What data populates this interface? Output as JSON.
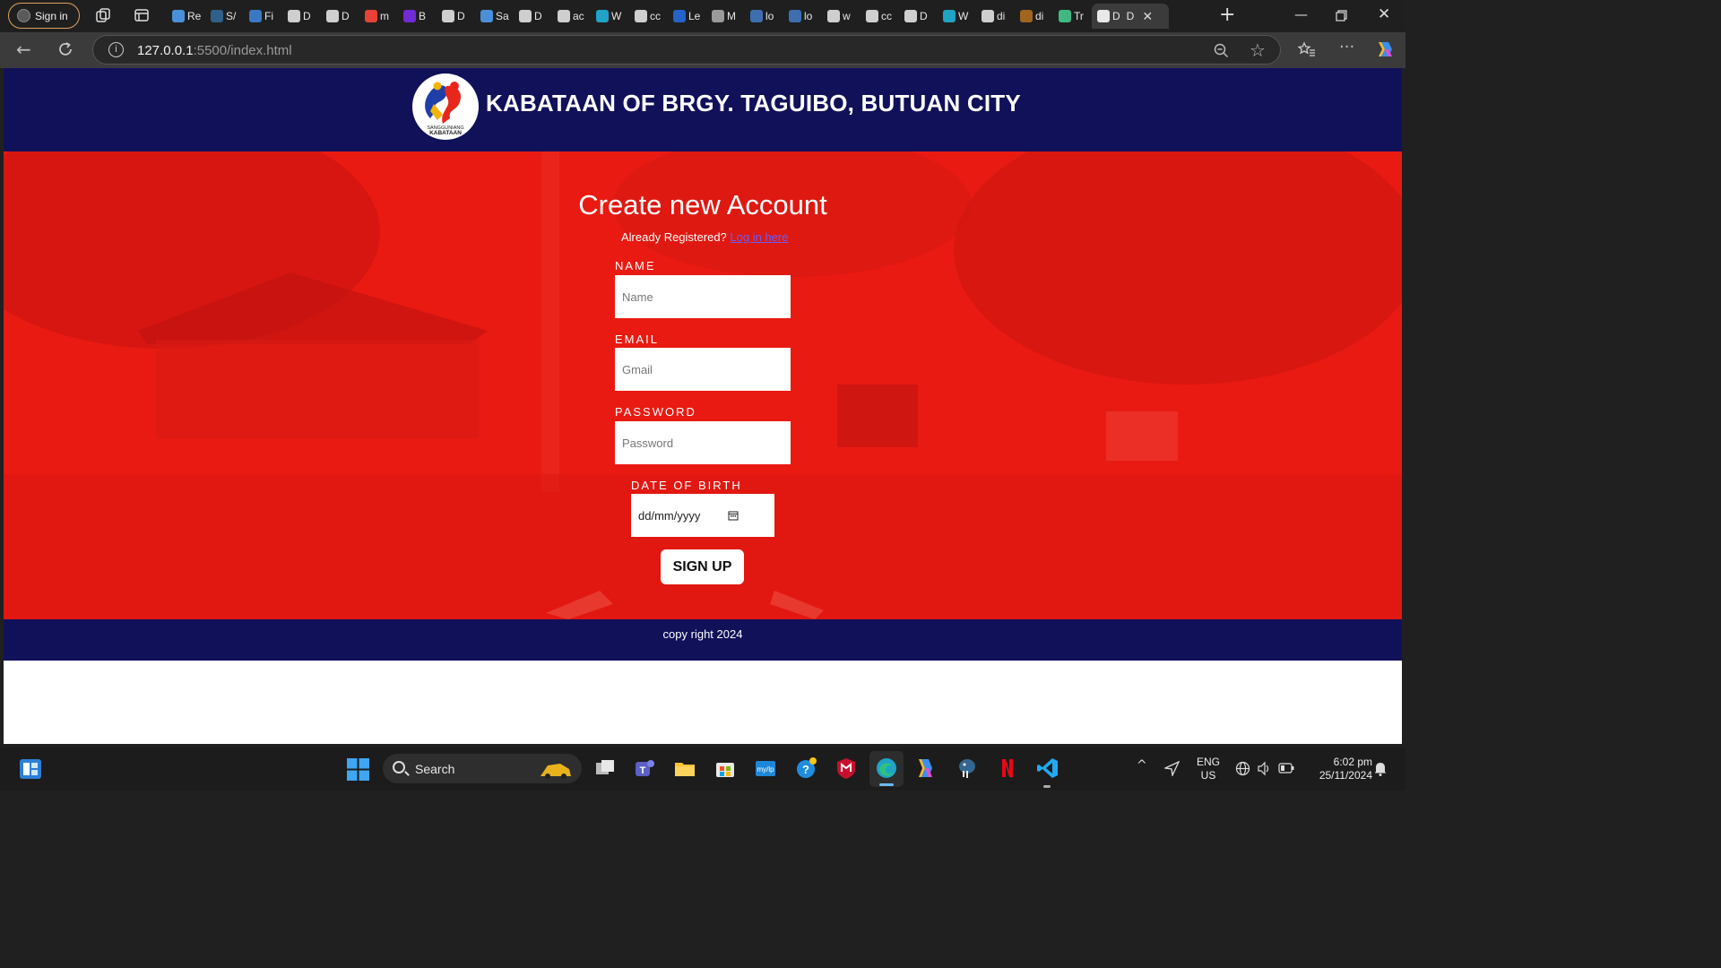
{
  "browser": {
    "signin_label": "Sign in",
    "tabs": [
      {
        "label": "Re",
        "icon": "arrow-icon",
        "color": "#4a90d9"
      },
      {
        "label": "S/",
        "icon": "globe-icon",
        "color": "#2f5f8a"
      },
      {
        "label": "Fi",
        "icon": "grid-icon",
        "color": "#3a78c2"
      },
      {
        "label": "D",
        "icon": "page-icon",
        "color": "#cfcfcf"
      },
      {
        "label": "D",
        "icon": "page-icon",
        "color": "#cfcfcf"
      },
      {
        "label": "m",
        "icon": "google-icon",
        "color": "#e94235"
      },
      {
        "label": "B",
        "icon": "bootstrap-icon",
        "color": "#6f2bd6"
      },
      {
        "label": "D",
        "icon": "page-icon",
        "color": "#cfcfcf"
      },
      {
        "label": "Sa",
        "icon": "arrow-icon",
        "color": "#4a90d9"
      },
      {
        "label": "D",
        "icon": "page-icon",
        "color": "#cfcfcf"
      },
      {
        "label": "ac",
        "icon": "page-icon",
        "color": "#cfcfcf"
      },
      {
        "label": "W",
        "icon": "edge-icon",
        "color": "#1fa3c6"
      },
      {
        "label": "cc",
        "icon": "page-icon",
        "color": "#cfcfcf"
      },
      {
        "label": "Le",
        "icon": "circle-icon",
        "color": "#2563c9"
      },
      {
        "label": "M",
        "icon": "figure-icon",
        "color": "#9a9a9a"
      },
      {
        "label": "lo",
        "icon": "search-icon",
        "color": "#3d6fb0"
      },
      {
        "label": "lo",
        "icon": "search-icon",
        "color": "#3d6fb0"
      },
      {
        "label": "w",
        "icon": "page-icon",
        "color": "#cfcfcf"
      },
      {
        "label": "cc",
        "icon": "page-icon",
        "color": "#cfcfcf"
      },
      {
        "label": "D",
        "icon": "page-icon",
        "color": "#cfcfcf"
      },
      {
        "label": "W",
        "icon": "edge-icon",
        "color": "#1fa3c6"
      },
      {
        "label": "di",
        "icon": "page-icon",
        "color": "#cfcfcf"
      },
      {
        "label": "di",
        "icon": "cookie-icon",
        "color": "#a0651f"
      },
      {
        "label": "Tr",
        "icon": "vue-icon",
        "color": "#41b883"
      }
    ],
    "active_tab_label": "D",
    "url_host": "127.0.0.1",
    "url_rest": ":5500/index.html"
  },
  "site": {
    "title": "KABATAAN OF BRGY. TAGUIBO, BUTUAN CITY",
    "logo_text_1": "SANGGUNIANG",
    "logo_text_2": "KABATAAN",
    "form_title": "Create new Account",
    "already_text": "Already Registered?",
    "login_link": "Log in here",
    "name_label": "NAME",
    "name_placeholder": "Name",
    "email_label": "EMAIL",
    "email_placeholder": "Gmail",
    "password_label": "PASSWORD",
    "password_placeholder": "Password",
    "dob_label": "DATE OF BIRTH",
    "dob_value": "dd/mm/yyyy",
    "signup_label": "SIGN UP",
    "footer": "copy right 2024",
    "colors": {
      "header": "#11115a",
      "hero": "#e91a12"
    }
  },
  "taskbar": {
    "search_label": "Search",
    "lang_1": "ENG",
    "lang_2": "US",
    "time": "6:02 pm",
    "date": "25/11/2024"
  }
}
